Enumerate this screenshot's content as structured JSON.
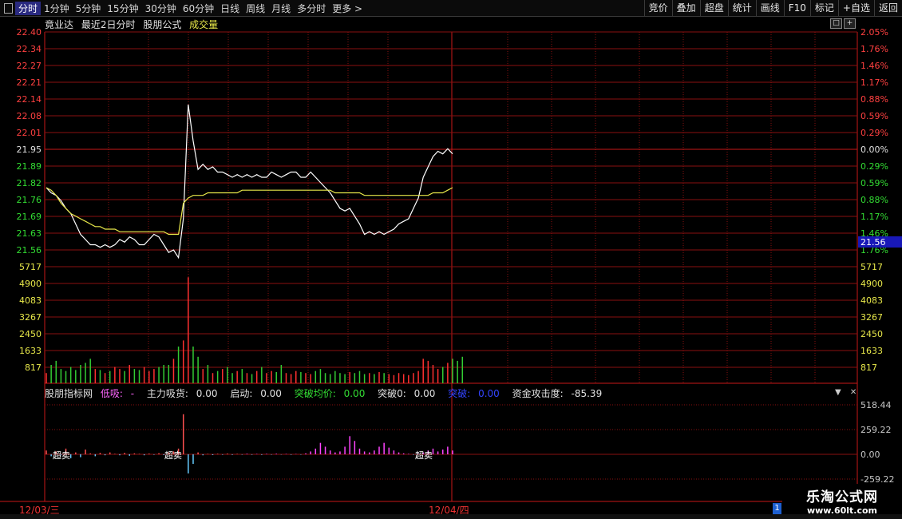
{
  "toolbar": {
    "period_tabs": [
      "分时",
      "1分钟",
      "5分钟",
      "15分钟",
      "30分钟",
      "60分钟",
      "日线",
      "周线",
      "月线",
      "多分时",
      "更多 >"
    ],
    "active_tab": 0,
    "right_buttons": [
      "竞价",
      "叠加",
      "超盘",
      "统计",
      "画线",
      "F10",
      "标记",
      "+自选",
      "返回"
    ]
  },
  "chart_header": {
    "stock_name": "竟业达",
    "mode": "最近2日分时",
    "formula": "股朋公式",
    "volume_label": "成交量"
  },
  "price_axis": {
    "left": [
      "22.40",
      "22.34",
      "22.27",
      "22.21",
      "22.14",
      "22.08",
      "22.01",
      "21.95",
      "21.89",
      "21.82",
      "21.76",
      "21.69",
      "21.63",
      "21.56"
    ],
    "right": [
      "2.05%",
      "1.76%",
      "1.46%",
      "1.17%",
      "0.88%",
      "0.59%",
      "0.29%",
      "0.00%",
      "0.29%",
      "0.59%",
      "0.88%",
      "1.17%",
      "1.46%",
      "1.76%"
    ],
    "current_price": "21.56"
  },
  "volume_axis": [
    "5717",
    "4900",
    "4083",
    "3267",
    "2450",
    "1633",
    "817"
  ],
  "indicator": {
    "name": "股朋指标网",
    "items": [
      {
        "label": "低吸:",
        "value": "-",
        "color": "#ff66ff"
      },
      {
        "label": "主力吸货:",
        "value": "0.00",
        "color": "#e0e0e0"
      },
      {
        "label": "启动:",
        "value": "0.00",
        "color": "#e0e0e0"
      },
      {
        "label": "突破均价:",
        "value": "0.00",
        "color": "#33dd33"
      },
      {
        "label": "突破0:",
        "value": "0.00",
        "color": "#e0e0e0"
      },
      {
        "label": "突破:",
        "value": "0.00",
        "color": "#3344ff"
      },
      {
        "label": "资金攻击度:",
        "value": "-85.39",
        "color": "#e0e0e0"
      }
    ],
    "axis": [
      "518.44",
      "259.22",
      "0.00",
      "-259.22"
    ],
    "markers": [
      "超卖",
      "超卖",
      "超卖"
    ]
  },
  "dates": [
    "12/03/三",
    "12/04/四"
  ],
  "watermark": {
    "title": "乐淘公式网",
    "url": "www.60lt.com"
  },
  "chart_data": [
    {
      "type": "line",
      "title": "",
      "ylim": [
        21.5,
        22.4
      ],
      "x_sessions": [
        "12/03/三",
        "12/04/四"
      ],
      "prev_close": 21.95,
      "series": [
        {
          "name": "",
          "color": "#ffffff",
          "values": [
            21.8,
            21.78,
            21.77,
            21.75,
            21.72,
            21.7,
            21.66,
            21.62,
            21.6,
            21.58,
            21.58,
            21.57,
            21.58,
            21.57,
            21.58,
            21.6,
            21.59,
            21.61,
            21.6,
            21.58,
            21.58,
            21.6,
            21.62,
            21.61,
            21.58,
            21.55,
            21.56,
            21.53,
            21.68,
            22.12,
            21.98,
            21.87,
            21.89,
            21.87,
            21.88,
            21.86,
            21.86,
            21.85,
            21.84,
            21.85,
            21.84,
            21.85,
            21.84,
            21.85,
            21.84,
            21.84,
            21.86,
            21.85,
            21.84,
            21.85,
            21.86,
            21.86,
            21.84,
            21.84,
            21.86,
            21.84,
            21.82,
            21.8,
            21.78,
            21.75,
            21.72,
            21.71,
            21.72,
            21.69,
            21.66,
            21.62,
            21.63,
            21.62,
            21.63,
            21.62,
            21.63,
            21.64,
            21.66,
            21.67,
            21.68,
            21.72,
            21.76,
            21.84,
            21.88,
            21.92,
            21.94,
            21.93,
            21.95,
            21.93
          ]
        },
        {
          "name": "",
          "color": "#e8e84a",
          "values": [
            21.8,
            21.79,
            21.77,
            21.74,
            21.72,
            21.7,
            21.69,
            21.68,
            21.67,
            21.66,
            21.65,
            21.65,
            21.64,
            21.64,
            21.64,
            21.63,
            21.63,
            21.63,
            21.63,
            21.63,
            21.63,
            21.63,
            21.63,
            21.63,
            21.63,
            21.62,
            21.62,
            21.62,
            21.74,
            21.76,
            21.77,
            21.77,
            21.77,
            21.78,
            21.78,
            21.78,
            21.78,
            21.78,
            21.78,
            21.78,
            21.79,
            21.79,
            21.79,
            21.79,
            21.79,
            21.79,
            21.79,
            21.79,
            21.79,
            21.79,
            21.79,
            21.79,
            21.79,
            21.79,
            21.79,
            21.79,
            21.79,
            21.79,
            21.79,
            21.78,
            21.78,
            21.78,
            21.78,
            21.78,
            21.78,
            21.77,
            21.77,
            21.77,
            21.77,
            21.77,
            21.77,
            21.77,
            21.77,
            21.77,
            21.77,
            21.77,
            21.77,
            21.77,
            21.77,
            21.78,
            21.78,
            21.78,
            21.79,
            21.8
          ]
        }
      ]
    },
    {
      "type": "bar",
      "title": "成交量",
      "ylim": [
        0,
        5717
      ],
      "series": [
        {
          "name": "",
          "values": [
            500,
            900,
            1100,
            700,
            600,
            800,
            650,
            900,
            1000,
            1200,
            700,
            650,
            500,
            600,
            800,
            700,
            600,
            900,
            700,
            650,
            800,
            600,
            700,
            800,
            900,
            900,
            1200,
            1800,
            2100,
            5200,
            1800,
            1300,
            700,
            900,
            500,
            600,
            700,
            800,
            500,
            600,
            700,
            500,
            450,
            600,
            800,
            500,
            600,
            550,
            900,
            500,
            450,
            600,
            550,
            500,
            450,
            600,
            700,
            500,
            450,
            600,
            500,
            450,
            550,
            500,
            600,
            450,
            500,
            450,
            550,
            500,
            450,
            400,
            500,
            450,
            400,
            500,
            600,
            1200,
            1100,
            900,
            700,
            800,
            1000,
            1200,
            1100,
            1300
          ]
        }
      ]
    },
    {
      "type": "bar",
      "title": "股朋指标网",
      "ylim": [
        -259.22,
        518.44
      ],
      "series": [
        {
          "name": "",
          "values": [
            40,
            -20,
            30,
            -10,
            60,
            -40,
            20,
            -30,
            50,
            10,
            -20,
            15,
            -10,
            20,
            5,
            -10,
            15,
            -15,
            10,
            5,
            -10,
            8,
            -5,
            12,
            -8,
            20,
            30,
            60,
            420,
            -200,
            -100,
            20,
            -10,
            5,
            -8,
            6,
            -5,
            8,
            -6,
            5,
            -4,
            6,
            -5,
            4,
            -6,
            5,
            -4,
            6,
            -3,
            4,
            -5,
            3,
            -4,
            10,
            30,
            60,
            120,
            80,
            40,
            20,
            30,
            80,
            190,
            140,
            60,
            30,
            20,
            40,
            80,
            120,
            70,
            40,
            20,
            10,
            5,
            -5,
            10,
            20,
            40,
            60,
            30,
            50,
            80,
            40
          ]
        }
      ]
    }
  ]
}
